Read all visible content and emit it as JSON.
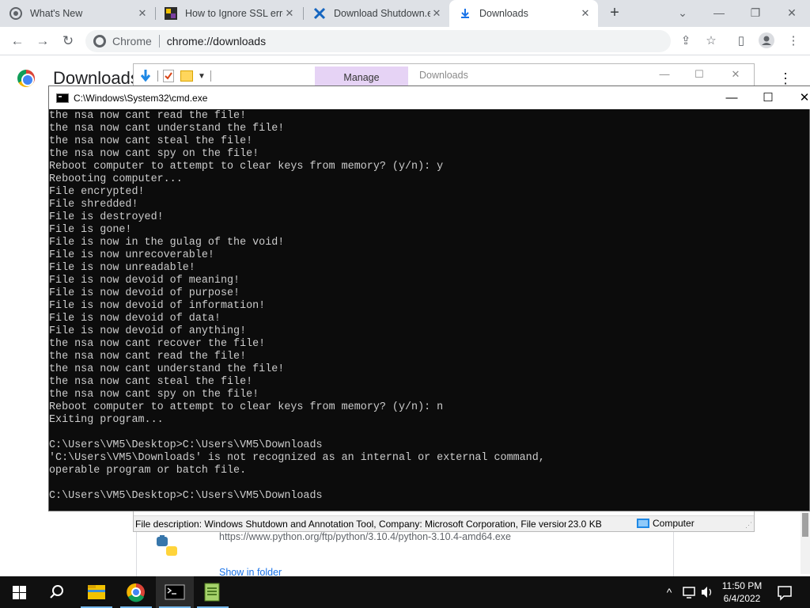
{
  "browser": {
    "tabs": [
      {
        "title": "What's New",
        "icon": "chrome-settings-icon"
      },
      {
        "title": "How to Ignore SSL error",
        "icon": "site-favicon"
      },
      {
        "title": "Download Shutdown.exe",
        "icon": "x-favicon"
      },
      {
        "title": "Downloads",
        "icon": "download-icon"
      }
    ],
    "new_tab": "+",
    "window_controls": {
      "chevron": "⌄",
      "minimize": "—",
      "restore": "❐",
      "close": "✕"
    },
    "omnibox": {
      "site": "Chrome",
      "url": "chrome://downloads"
    }
  },
  "downloads_page": {
    "title": "Downloads",
    "item_url": "https://www.python.org/ftp/python/3.10.4/python-3.10.4-amd64.exe",
    "show_in_folder": "Show in folder"
  },
  "explorer": {
    "manage_tab": "Manage",
    "downloads_tab": "Downloads",
    "status": {
      "description": "File description: Windows Shutdown and Annotation Tool, Company: Microsoft Corporation, File version",
      "size": "23.0 KB",
      "zone": "Computer"
    }
  },
  "cmd": {
    "title": "C:\\Windows\\System32\\cmd.exe",
    "lines": [
      "the nsa now cant read the file!",
      "the nsa now cant understand the file!",
      "the nsa now cant steal the file!",
      "the nsa now cant spy on the file!",
      "Reboot computer to attempt to clear keys from memory? (y/n): y",
      "Rebooting computer...",
      "File encrypted!",
      "File shredded!",
      "File is destroyed!",
      "File is gone!",
      "File is now in the gulag of the void!",
      "File is now unrecoverable!",
      "File is now unreadable!",
      "File is now devoid of meaning!",
      "File is now devoid of purpose!",
      "File is now devoid of information!",
      "File is now devoid of data!",
      "File is now devoid of anything!",
      "the nsa now cant recover the file!",
      "the nsa now cant read the file!",
      "the nsa now cant understand the file!",
      "the nsa now cant steal the file!",
      "the nsa now cant spy on the file!",
      "Reboot computer to attempt to clear keys from memory? (y/n): n",
      "Exiting program...",
      "",
      "C:\\Users\\VM5\\Desktop>C:\\Users\\VM5\\Downloads",
      "'C:\\Users\\VM5\\Downloads' is not recognized as an internal or external command,",
      "operable program or batch file.",
      "",
      "C:\\Users\\VM5\\Desktop>C:\\Users\\VM5\\Downloads"
    ]
  },
  "taskbar": {
    "apps": [
      "start-icon",
      "search-icon",
      "file-explorer-icon",
      "chrome-icon",
      "cmd-icon",
      "notepad-icon"
    ],
    "tray": {
      "chevron": "^",
      "time": "11:50 PM",
      "date": "6/4/2022"
    }
  }
}
